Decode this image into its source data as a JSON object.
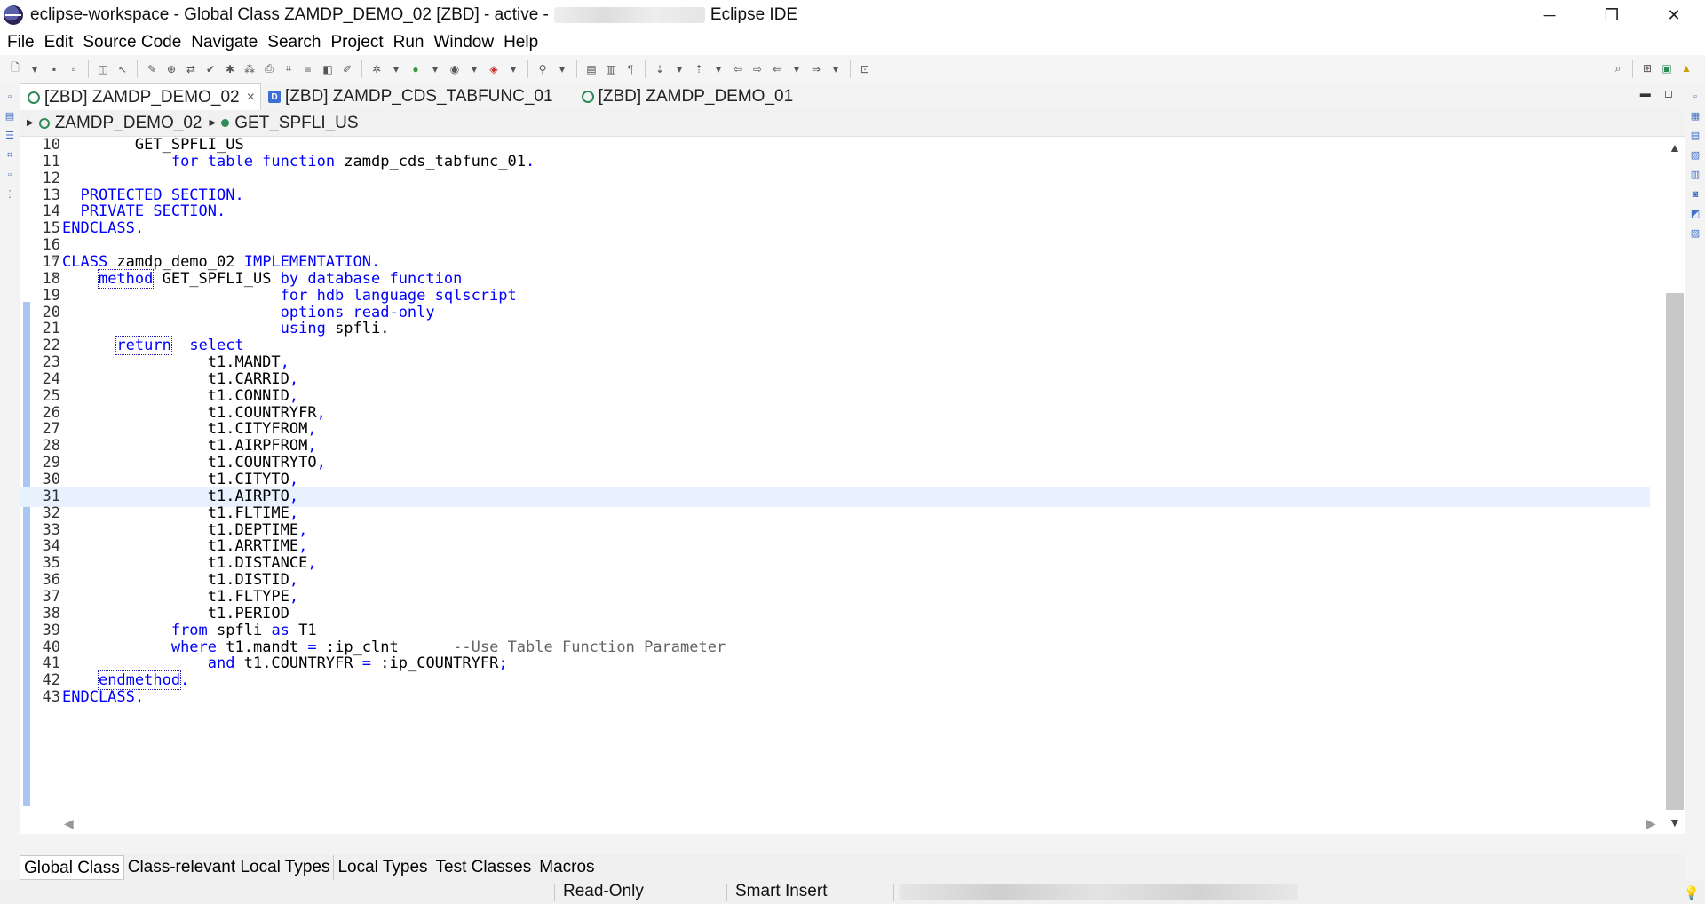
{
  "window": {
    "title_prefix": "eclipse-workspace - Global Class ZAMDP_DEMO_02 [ZBD]  - active -",
    "title_suffix": "Eclipse IDE",
    "minimize": "─",
    "restore": "❐",
    "close": "✕"
  },
  "menu": [
    "File",
    "Edit",
    "Source Code",
    "Navigate",
    "Search",
    "Project",
    "Run",
    "Window",
    "Help"
  ],
  "tabs": [
    {
      "label": "[ZBD] ZAMDP_DEMO_02",
      "icon": "class-icon",
      "active": true,
      "close": "×"
    },
    {
      "label": "[ZBD] ZAMDP_CDS_TABFUNC_01",
      "icon": "ddl-icon",
      "icon_text": "D",
      "active": false
    },
    {
      "label": "[ZBD] ZAMDP_DEMO_01",
      "icon": "class-icon",
      "active": false
    }
  ],
  "breadcrumb": {
    "class": "ZAMDP_DEMO_02",
    "method": "GET_SPFLI_US"
  },
  "editor": {
    "current_line": 31,
    "lines": [
      {
        "n": "10",
        "indent": "        ",
        "segs": [
          [
            "t",
            "GET_SPFLI_US"
          ]
        ]
      },
      {
        "n": "11",
        "indent": "            ",
        "segs": [
          [
            "k",
            "for table function"
          ],
          [
            "t",
            " zamdp_cds_tabfunc_01"
          ],
          [
            "k",
            "."
          ]
        ]
      },
      {
        "n": "12",
        "indent": "",
        "segs": []
      },
      {
        "n": "13",
        "indent": "  ",
        "segs": [
          [
            "k",
            "PROTECTED SECTION."
          ]
        ]
      },
      {
        "n": "14",
        "indent": "  ",
        "segs": [
          [
            "k",
            "PRIVATE SECTION."
          ]
        ]
      },
      {
        "n": "15",
        "indent": "",
        "segs": [
          [
            "k",
            "ENDCLASS."
          ]
        ]
      },
      {
        "n": "16",
        "indent": "",
        "segs": []
      },
      {
        "n": "17",
        "fold": "⊖",
        "indent": "",
        "segs": [
          [
            "k",
            "CLASS"
          ],
          [
            "t",
            " zamdp_demo_02 "
          ],
          [
            "k",
            "IMPLEMENTATION."
          ]
        ]
      },
      {
        "n": "18",
        "fold": "⊖",
        "indent": "    ",
        "segs": [
          [
            "kb",
            "method"
          ],
          [
            "t",
            " GET_SPFLI_US "
          ],
          [
            "k",
            "by database function"
          ]
        ]
      },
      {
        "n": "19",
        "indent": "                        ",
        "segs": [
          [
            "k",
            "for hdb language sqlscript"
          ]
        ]
      },
      {
        "n": "20",
        "indent": "                        ",
        "segs": [
          [
            "k",
            "options read-only"
          ]
        ]
      },
      {
        "n": "21",
        "indent": "                        ",
        "segs": [
          [
            "k",
            "using"
          ],
          [
            "t",
            " spfli."
          ]
        ]
      },
      {
        "n": "22",
        "indent": "      ",
        "segs": [
          [
            "kb",
            "return"
          ],
          [
            "t",
            "  "
          ],
          [
            "k",
            "select"
          ]
        ]
      },
      {
        "n": "23",
        "indent": "                ",
        "segs": [
          [
            "t",
            "t1.MANDT"
          ],
          [
            "k",
            ","
          ]
        ]
      },
      {
        "n": "24",
        "indent": "                ",
        "segs": [
          [
            "t",
            "t1.CARRID"
          ],
          [
            "k",
            ","
          ]
        ]
      },
      {
        "n": "25",
        "indent": "                ",
        "segs": [
          [
            "t",
            "t1.CONNID"
          ],
          [
            "k",
            ","
          ]
        ]
      },
      {
        "n": "26",
        "indent": "                ",
        "segs": [
          [
            "t",
            "t1.COUNTRYFR"
          ],
          [
            "k",
            ","
          ]
        ]
      },
      {
        "n": "27",
        "indent": "                ",
        "segs": [
          [
            "t",
            "t1.CITYFROM"
          ],
          [
            "k",
            ","
          ]
        ]
      },
      {
        "n": "28",
        "indent": "                ",
        "segs": [
          [
            "t",
            "t1.AIRPFROM"
          ],
          [
            "k",
            ","
          ]
        ]
      },
      {
        "n": "29",
        "indent": "                ",
        "segs": [
          [
            "t",
            "t1.COUNTRYTO"
          ],
          [
            "k",
            ","
          ]
        ]
      },
      {
        "n": "30",
        "indent": "                ",
        "segs": [
          [
            "t",
            "t1.CITYTO"
          ],
          [
            "k",
            ","
          ]
        ]
      },
      {
        "n": "31",
        "indent": "                ",
        "segs": [
          [
            "t",
            "t1.AIRPTO"
          ],
          [
            "k",
            ","
          ]
        ]
      },
      {
        "n": "32",
        "indent": "                ",
        "segs": [
          [
            "t",
            "t1.FLTIME"
          ],
          [
            "k",
            ","
          ]
        ]
      },
      {
        "n": "33",
        "indent": "                ",
        "segs": [
          [
            "t",
            "t1.DEPTIME"
          ],
          [
            "k",
            ","
          ]
        ]
      },
      {
        "n": "34",
        "indent": "                ",
        "segs": [
          [
            "t",
            "t1.ARRTIME"
          ],
          [
            "k",
            ","
          ]
        ]
      },
      {
        "n": "35",
        "indent": "                ",
        "segs": [
          [
            "t",
            "t1.DISTANCE"
          ],
          [
            "k",
            ","
          ]
        ]
      },
      {
        "n": "36",
        "indent": "                ",
        "segs": [
          [
            "t",
            "t1.DISTID"
          ],
          [
            "k",
            ","
          ]
        ]
      },
      {
        "n": "37",
        "indent": "                ",
        "segs": [
          [
            "t",
            "t1.FLTYPE"
          ],
          [
            "k",
            ","
          ]
        ]
      },
      {
        "n": "38",
        "indent": "                ",
        "segs": [
          [
            "t",
            "t1.PERIOD"
          ]
        ]
      },
      {
        "n": "39",
        "indent": "            ",
        "segs": [
          [
            "k",
            "from"
          ],
          [
            "t",
            " spfli "
          ],
          [
            "k",
            "as"
          ],
          [
            "t",
            " T1"
          ]
        ]
      },
      {
        "n": "40",
        "indent": "            ",
        "segs": [
          [
            "k",
            "where"
          ],
          [
            "t",
            " t1.mandt "
          ],
          [
            "k",
            "="
          ],
          [
            "t",
            " :ip_clnt      "
          ],
          [
            "c",
            "--Use Table Function Parameter"
          ]
        ]
      },
      {
        "n": "41",
        "indent": "                ",
        "segs": [
          [
            "k",
            "and"
          ],
          [
            "t",
            " t1.COUNTRYFR "
          ],
          [
            "k",
            "="
          ],
          [
            "t",
            " :ip_COUNTRYFR"
          ],
          [
            "k",
            ";"
          ]
        ]
      },
      {
        "n": "42",
        "indent": "    ",
        "segs": [
          [
            "kb",
            "endmethod"
          ],
          [
            "k",
            "."
          ]
        ]
      },
      {
        "n": "43",
        "indent": "",
        "segs": [
          [
            "k",
            "ENDCLASS."
          ]
        ]
      }
    ]
  },
  "bottom_tabs": [
    {
      "label": "Global Class",
      "active": true
    },
    {
      "label": "Class-relevant Local Types",
      "active": false
    },
    {
      "label": "Local Types",
      "active": false
    },
    {
      "label": "Test Classes",
      "active": false
    },
    {
      "label": "Macros",
      "active": false
    }
  ],
  "status": {
    "mode": "Read-Only",
    "insert": "Smart Insert"
  },
  "colors": {
    "keyword": "#0000ff",
    "comment": "#646464",
    "current_line": "#e8f2fe",
    "change_bar": "#a7c8f5"
  }
}
